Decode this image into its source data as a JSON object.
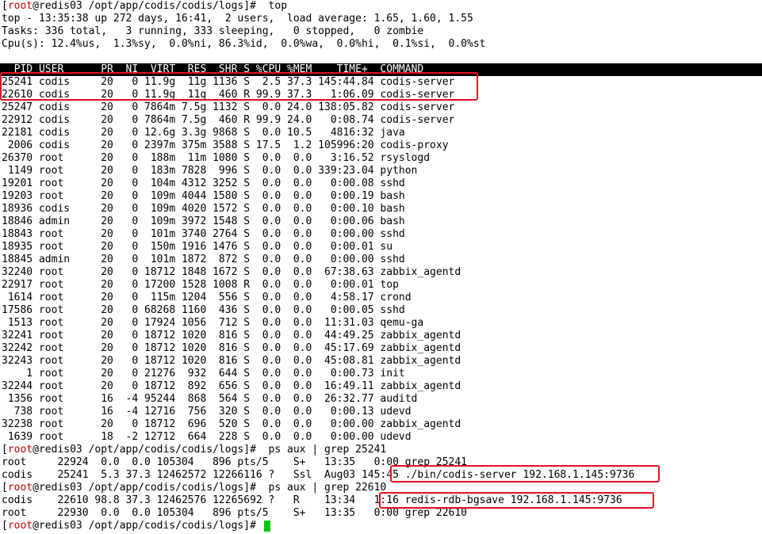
{
  "terminal": {
    "colors": {
      "text": "#000000",
      "background": "#ffffff",
      "prompt_user": "#c00000",
      "highlight": "#e8101e",
      "cursor": "#00c800"
    },
    "prompt": {
      "user": "root",
      "rest": "@redis03 /opt/app/codis/codis/logs]#",
      "open": "["
    },
    "lines": [
      {
        "u": "root",
        "r": "@redis03 /opt/app/codis/codis/logs]#  top"
      },
      {
        "t": "top - 13:35:38 up 272 days, 16:41,  2 users,  load average: 1.65, 1.60, 1.55"
      },
      {
        "t": "Tasks: 336 total,   3 running, 333 sleeping,   0 stopped,   0 zombie"
      },
      {
        "t": "Cpu(s): 12.4%us,  1.3%sy,  0.0%ni, 86.3%id,  0.0%wa,  0.0%hi,  0.1%si,  0.0%st"
      },
      {
        "t": ""
      },
      {
        "t": "  PID USER      PR  NI  VIRT  RES  SHR S %CPU %MEM    TIME+  COMMAND",
        "header": true
      },
      {
        "t": "25241 codis     20   0 11.9g  11g 1136 S  2.5 37.3 145:44.84 codis-server"
      },
      {
        "t": "22610 codis     20   0 11.9g  11g  460 R 99.9 37.3   1:06.09 codis-server"
      },
      {
        "t": "25247 codis     20   0 7864m 7.5g 1132 S  0.0 24.0 138:05.82 codis-server"
      },
      {
        "t": "22912 codis     20   0 7864m 7.5g  460 R 99.9 24.0   0:08.74 codis-server"
      },
      {
        "t": "22181 codis     20   0 12.6g 3.3g 9868 S  0.0 10.5   4816:32 java"
      },
      {
        "t": " 2006 codis     20   0 2397m 375m 3588 S 17.5  1.2 105996:20 codis-proxy"
      },
      {
        "t": "26370 root      20   0  188m  11m 1080 S  0.0  0.0   3:16.52 rsyslogd"
      },
      {
        "t": " 1149 root      20   0  183m 7828  996 S  0.0  0.0 339:23.04 python"
      },
      {
        "t": "19201 root      20   0  104m 4312 3252 S  0.0  0.0   0:00.08 sshd"
      },
      {
        "t": "19203 root      20   0  109m 4044 1580 S  0.0  0.0   0:00.19 bash"
      },
      {
        "t": "18936 codis     20   0  109m 4020 1572 S  0.0  0.0   0:00.10 bash"
      },
      {
        "t": "18846 admin     20   0  109m 3972 1548 S  0.0  0.0   0:00.06 bash"
      },
      {
        "t": "18843 root      20   0  101m 3740 2764 S  0.0  0.0   0:00.00 sshd"
      },
      {
        "t": "18935 root      20   0  150m 1916 1476 S  0.0  0.0   0:00.01 su"
      },
      {
        "t": "18845 admin     20   0  101m 1872  872 S  0.0  0.0   0:00.00 sshd"
      },
      {
        "t": "32240 root      20   0 18712 1848 1672 S  0.0  0.0  67:38.63 zabbix_agentd"
      },
      {
        "t": "22917 root      20   0 17200 1528 1008 R  0.0  0.0   0:00.01 top"
      },
      {
        "t": " 1614 root      20   0  115m 1204  556 S  0.0  0.0   4:58.17 crond"
      },
      {
        "t": "17586 root      20   0 68268 1160  436 S  0.0  0.0   0:00.05 sshd"
      },
      {
        "t": " 1513 root      20   0 17924 1056  712 S  0.0  0.0  11:31.03 qemu-ga"
      },
      {
        "t": "32241 root      20   0 18712 1020  816 S  0.0  0.0  44:49.25 zabbix_agentd"
      },
      {
        "t": "32242 root      20   0 18712 1020  816 S  0.0  0.0  45:17.69 zabbix_agentd"
      },
      {
        "t": "32243 root      20   0 18712 1020  816 S  0.0  0.0  45:08.81 zabbix_agentd"
      },
      {
        "t": "    1 root      20   0 21276  932  644 S  0.0  0.0   0:00.73 init"
      },
      {
        "t": "32244 root      20   0 18712  892  656 S  0.0  0.0  16:49.11 zabbix_agentd"
      },
      {
        "t": " 1356 root      16  -4 95244  868  564 S  0.0  0.0  26:32.77 auditd"
      },
      {
        "t": "  738 root      16  -4 12716  756  320 S  0.0  0.0   0:00.13 udevd"
      },
      {
        "t": "32238 root      20   0 18712  696  520 S  0.0  0.0   0:00.00 zabbix_agentd"
      },
      {
        "t": " 1639 root      18  -2 12712  664  228 S  0.0  0.0   0:00.00 udevd"
      },
      {
        "u": "root",
        "r": "@redis03 /opt/app/codis/codis/logs]#  ps aux | grep 25241"
      },
      {
        "t": "root     22924  0.0  0.0 105304   896 pts/5    S+   13:35   0:00 grep 25241"
      },
      {
        "t": "codis    25241  5.3 37.3 12462572 12266116 ?   Ssl  Aug03 145:45 ./bin/codis-server 192.168.1.145:9736"
      },
      {
        "u": "root",
        "r": "@redis03 /opt/app/codis/codis/logs]#  ps aux | grep 22610"
      },
      {
        "t": "codis    22610 98.8 37.3 12462576 12265692 ?   R    13:34   1:16 redis-rdb-bgsave 192.168.1.145:9736"
      },
      {
        "t": "root     22930  0.0  0.0 105304   896 pts/5    S+   13:35   0:00 grep 22610"
      },
      {
        "u": "root",
        "r": "@redis03 /opt/app/codis/codis/logs]# ",
        "cursor": true
      }
    ]
  }
}
